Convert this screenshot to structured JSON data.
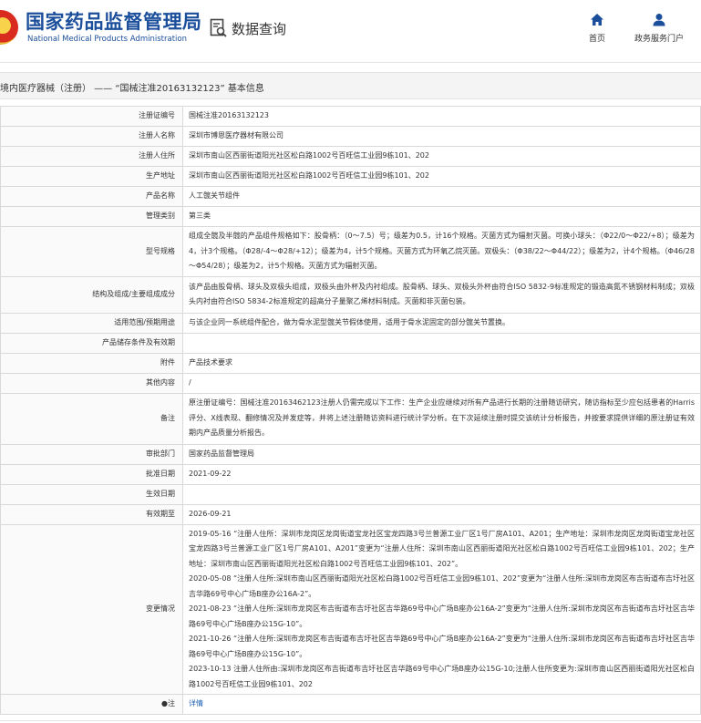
{
  "header": {
    "logo_cn": "国家药品监督管理局",
    "logo_en": "National Medical Products Administration",
    "query_label": "数据查询",
    "nav": [
      {
        "label": "首页",
        "icon": "home-icon"
      },
      {
        "label": "政务服务门户",
        "icon": "user-icon"
      }
    ],
    "brand_color": "#1b4e9b"
  },
  "title": "境内医疗器械（注册） —— “国械注准20163132123” 基本信息",
  "rows": [
    {
      "label": "注册证编号",
      "value": "国械注准20163132123"
    },
    {
      "label": "注册人名称",
      "value": "深圳市博恩医疗器材有限公司"
    },
    {
      "label": "注册人住所",
      "value": "深圳市南山区西丽街道阳光社区松白路1002号百旺信工业园9栋101、202"
    },
    {
      "label": "生产地址",
      "value": "深圳市南山区西丽街道阳光社区松白路1002号百旺信工业园9栋101、202"
    },
    {
      "label": "产品名称",
      "value": "人工髋关节组件"
    },
    {
      "label": "管理类别",
      "value": "第三类"
    },
    {
      "label": "型号规格",
      "value": "组成全髋及半髋的产品组件规格如下：股骨柄：（0～7.5）号；级差为0.5，计16个规格。灭菌方式为辐射灭菌。可换小球头：（Φ22/0～Φ22/+8）；级差为4，计3个规格。（Φ28/-4～Φ28/+12）；级差为4，计5个规格。灭菌方式为环氧乙烷灭菌。双极头：（Φ38/22～Φ44/22）；级差为2，计4个规格。（Φ46/28～Φ54/28）；级差为2，计5个规格。灭菌方式为辐射灭菌。"
    },
    {
      "label": "结构及组成/主要组成成分",
      "value": "该产品由股骨柄、球头及双极头组成，双极头由外杯及内衬组成。股骨柄、球头、双极头外杯由符合ISO 5832-9标准规定的锻造高氮不锈钢材料制成；双极头内衬由符合ISO 5834-2标准规定的超高分子量聚乙烯材料制成。灭菌和非灭菌包装。"
    },
    {
      "label": "适用范围/预期用途",
      "value": "与该企业同一系统组件配合，做为骨水泥型髋关节假体使用，适用于骨水泥固定的部分髋关节置换。"
    },
    {
      "label": "产品储存条件及有效期",
      "value": ""
    },
    {
      "label": "附件",
      "value": "产品技术要求"
    },
    {
      "label": "其他内容",
      "value": "/"
    },
    {
      "label": "备注",
      "value": "原注册证编号：国械注准20163462123注册人仍需完成以下工作：生产企业应继续对所有产品进行长期的注册随访研究，随访指标至少应包括患者的Harris评分、X线表现、翻修情况及并发症等，并将上述注册随访资料进行统计学分析。在下次延续注册时提交该统计分析报告，并按要求提供详细的原注册证有效期内产品质量分析报告。"
    },
    {
      "label": "审批部门",
      "value": "国家药品监督管理局"
    },
    {
      "label": "批准日期",
      "value": "2021-09-22"
    },
    {
      "label": "生效日期",
      "value": ""
    },
    {
      "label": "有效期至",
      "value": "2026-09-21"
    }
  ],
  "changes": {
    "label": "变更情况",
    "lines": [
      "2019-05-16 “注册人住所：深圳市龙岗区龙岗街道宝龙社区宝龙四路3号兰普源工业厂区1号厂房A101、A201；生产地址：深圳市龙岗区龙岗街道宝龙社区宝龙四路3号兰普源工业厂区1号厂房A101、A201”变更为“注册人住所：深圳市南山区西丽街道阳光社区松白路1002号百旺信工业园9栋101、202；生产地址：深圳市南山区西丽街道阳光社区松白路1002号百旺信工业园9栋101、202”。",
      "2020-05-08 “注册人住所:深圳市南山区西丽街道阳光社区松白路1002号百旺信工业园9栋101、202”变更为“注册人住所:深圳市龙岗区布吉街道布吉圩社区吉华路69号中心广场B座办公16A-2”。",
      "2021-08-23 “注册人住所:深圳市龙岗区布吉街道布吉圩社区吉华路69号中心广场B座办公16A-2”变更为“注册人住所:深圳市龙岗区布吉街道布吉圩社区吉华路69号中心广场B座办公15G-10”。",
      "2021-10-26 “注册人住所:深圳市龙岗区布吉街道布吉圩社区吉华路69号中心广场B座办公16A-2”变更为“注册人住所:深圳市龙岗区布吉街道布吉圩社区吉华路69号中心广场B座办公15G-10”。",
      "2023-10-13 注册人住所由:深圳市龙岗区布吉街道布吉圩社区吉华路69号中心广场B座办公15G-10;注册人住所变更为:深圳市南山区西丽街道阳光社区松白路1002号百旺信工业园9栋101、202"
    ]
  },
  "note_row": {
    "label": "●注",
    "link": "详情"
  }
}
